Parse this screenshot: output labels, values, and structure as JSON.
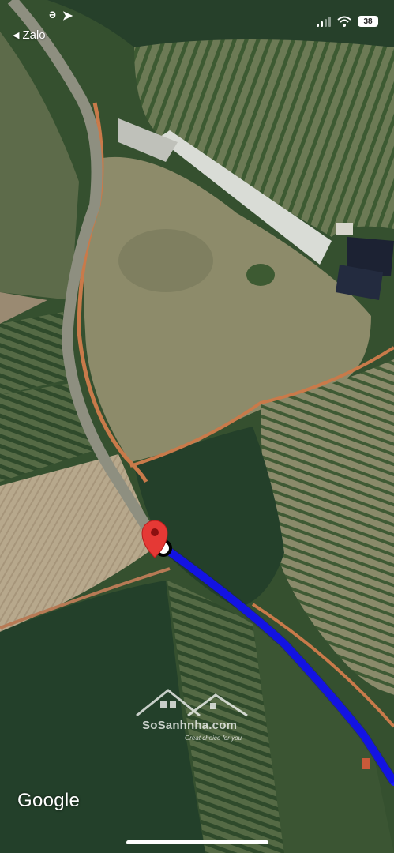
{
  "status_bar": {
    "back_app_label": "Zalo",
    "left_icons": [
      "ə",
      "➤"
    ],
    "battery_label": "38",
    "wifi_icon": "wifi-icon",
    "signal_icon": "cellular-signal-icon"
  },
  "map": {
    "provider_label": "Google",
    "map_type": "satellite",
    "route_color": "#1a1aff",
    "pin_color": "#e53935",
    "road_color": "#c97a4a"
  },
  "watermark": {
    "brand": "SoSanhnha.com",
    "tagline": "Great choice for you"
  }
}
